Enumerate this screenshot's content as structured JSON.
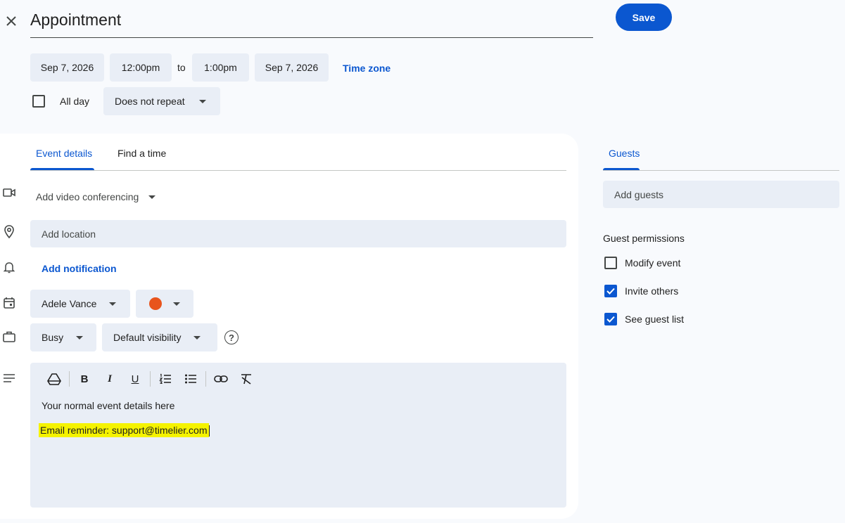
{
  "header": {
    "title": "Appointment",
    "save_label": "Save"
  },
  "datetime": {
    "start_date": "Sep 7, 2026",
    "start_time": "12:00pm",
    "to_label": "to",
    "end_time": "1:00pm",
    "end_date": "Sep 7, 2026",
    "timezone_label": "Time zone",
    "all_day_label": "All day",
    "repeat_label": "Does not repeat"
  },
  "tabs": {
    "event_details": "Event details",
    "find_time": "Find a time",
    "guests": "Guests"
  },
  "details": {
    "video_conferencing": "Add video conferencing",
    "location_placeholder": "Add location",
    "add_notification": "Add notification",
    "calendar_owner": "Adele Vance",
    "event_color": "#e8541c",
    "status": "Busy",
    "visibility": "Default visibility"
  },
  "editor": {
    "line1": "Your normal event details here",
    "line2": "Email reminder: support@timelier.com"
  },
  "guests": {
    "placeholder": "Add guests",
    "permissions_title": "Guest permissions",
    "permissions": [
      {
        "label": "Modify event",
        "checked": false
      },
      {
        "label": "Invite others",
        "checked": true
      },
      {
        "label": "See guest list",
        "checked": true
      }
    ]
  },
  "colors": {
    "accent": "#0b57d0",
    "highlight": "#f5f300"
  }
}
